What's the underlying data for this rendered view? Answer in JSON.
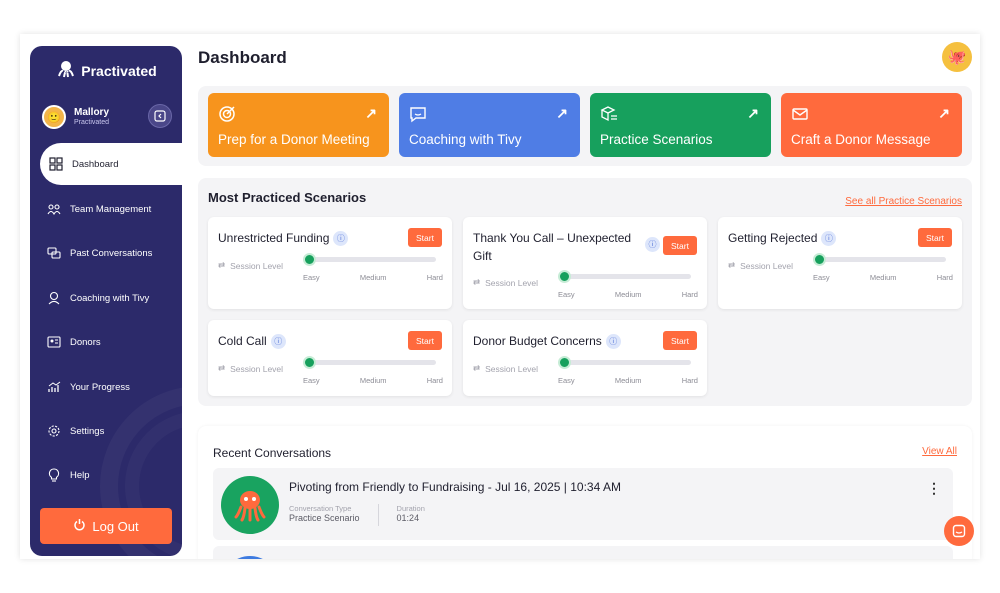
{
  "sidebar": {
    "brand": "Practivated",
    "profile": {
      "name": "Mallory",
      "org": "Practivated"
    },
    "items": [
      {
        "label": "Dashboard",
        "icon": "grid-icon",
        "active": true
      },
      {
        "label": "Team Management",
        "icon": "team-icon"
      },
      {
        "label": "Past Conversations",
        "icon": "chat-history-icon"
      },
      {
        "label": "Coaching with Tivy",
        "icon": "coach-icon"
      },
      {
        "label": "Donors",
        "icon": "id-card-icon"
      },
      {
        "label": "Your Progress",
        "icon": "progress-chart-icon"
      },
      {
        "label": "Settings",
        "icon": "gear-icon"
      },
      {
        "label": "Help",
        "icon": "lightbulb-icon"
      }
    ],
    "logout_label": "Log Out"
  },
  "header": {
    "title": "Dashboard"
  },
  "quick_actions": [
    {
      "label": "Prep for a Donor Meeting",
      "color": "#f7941d",
      "icon": "target-icon"
    },
    {
      "label": "Coaching with Tivy",
      "color": "#4f7de5",
      "icon": "message-smile-icon"
    },
    {
      "label": "Practice Scenarios",
      "color": "#17a05d",
      "icon": "box-list-icon"
    },
    {
      "label": "Craft a Donor Message",
      "color": "#ff6a3d",
      "icon": "mail-icon"
    }
  ],
  "scenarios": {
    "title": "Most Practiced Scenarios",
    "see_all": "See all Practice Scenarios",
    "session_label": "Session Level",
    "levels": [
      "Easy",
      "Medium",
      "Hard"
    ],
    "start_label": "Start",
    "items": [
      {
        "name": "Unrestricted Funding",
        "level": 0
      },
      {
        "name": "Thank You Call – Unexpected Gift",
        "level": 0
      },
      {
        "name": "Getting Rejected",
        "level": 0
      },
      {
        "name": "Cold Call",
        "level": 0
      },
      {
        "name": "Donor Budget Concerns",
        "level": 0
      }
    ]
  },
  "recent": {
    "title": "Recent Conversations",
    "view_all": "View All",
    "items": [
      {
        "title": "Pivoting from Friendly to Fundraising - Jul 16, 2025 | 10:34 AM",
        "type_label": "Conversation Type",
        "type_value": "Practice Scenario",
        "duration_label": "Duration",
        "duration_value": "01:24"
      }
    ]
  }
}
